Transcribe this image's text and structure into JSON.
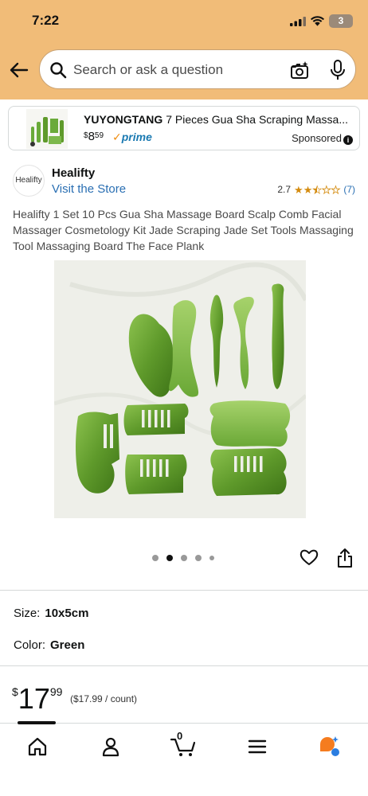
{
  "status_bar": {
    "time": "7:22",
    "battery": "3"
  },
  "search": {
    "placeholder": "Search or ask a question"
  },
  "sponsored": {
    "brand": "YUYONGTANG",
    "title_rest": "7 Pieces Gua Sha Scraping Massa...",
    "price_dollars": "8",
    "price_cents": "59",
    "prime": "prime",
    "sponsored_label": "Sponsored"
  },
  "seller": {
    "logo_text": "Healifty",
    "name": "Healifty",
    "visit_store": "Visit the Store",
    "rating": "2.7",
    "review_count": "(7)",
    "stars": 2.7
  },
  "product": {
    "title": "Healifty 1 Set 10 Pcs Gua Sha Massage Board Scalp Comb Facial Massager Cosmetology Kit Jade Scraping Jade Set Tools Massaging Tool Massaging Board The Face Plank",
    "carousel_active_index": 1,
    "carousel_count": 5
  },
  "options": {
    "size_label": "Size:",
    "size_value": "10x5cm",
    "color_label": "Color:",
    "color_value": "Green"
  },
  "price": {
    "currency": "$",
    "whole": "17",
    "cents": "99",
    "unit_price": "($17.99 / count)"
  },
  "nav": {
    "cart_count": "0",
    "items": [
      "home-icon",
      "account-icon",
      "cart-icon",
      "menu-icon",
      "rufus-icon"
    ]
  },
  "colors": {
    "header": "#f1bc78",
    "link": "#2a6fb3",
    "star": "#d48b0f",
    "jade": "#5f9a2b"
  }
}
